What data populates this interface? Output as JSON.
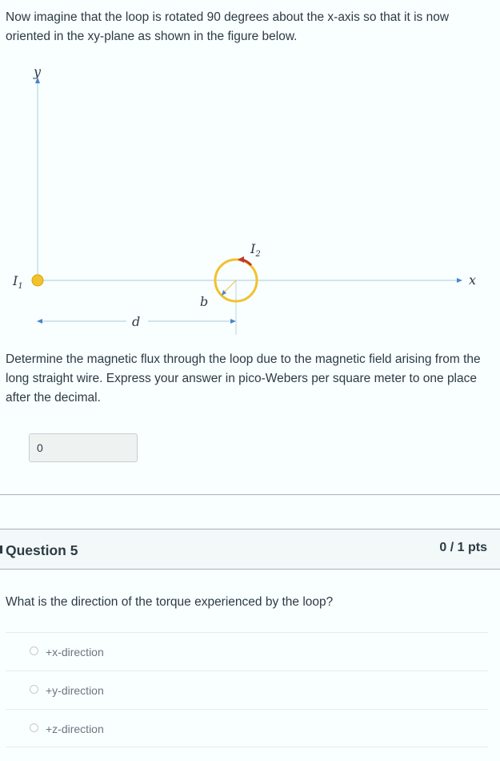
{
  "question4": {
    "intro": "Now imagine that the loop is rotated 90 degrees about the x-axis so that it is now oriented in the xy-plane as shown in the figure below.",
    "figure": {
      "y_label": "y",
      "x_label": "x",
      "wire_label": "I",
      "wire_subscript": "1",
      "loop_label": "I",
      "loop_subscript": "2",
      "radius_label": "b",
      "distance_label": "d",
      "axis_color": "#b9d6e6",
      "arrow_color": "#4a86c8",
      "loop_color": "#f2c12e",
      "current_arrow_color": "#c0392b"
    },
    "prompt": "Determine the magnetic flux through the loop due to the magnetic field arising from the long straight wire.  Express your answer in pico-Webers per square meter to one place after the decimal.",
    "answer_value": "0"
  },
  "question5": {
    "title": "Question 5",
    "points": "0 / 1 pts",
    "text": "What is the direction of the torque experienced by the loop?",
    "options": [
      {
        "label": "+x-direction"
      },
      {
        "label": "+y-direction"
      },
      {
        "label": "+z-direction"
      }
    ]
  }
}
